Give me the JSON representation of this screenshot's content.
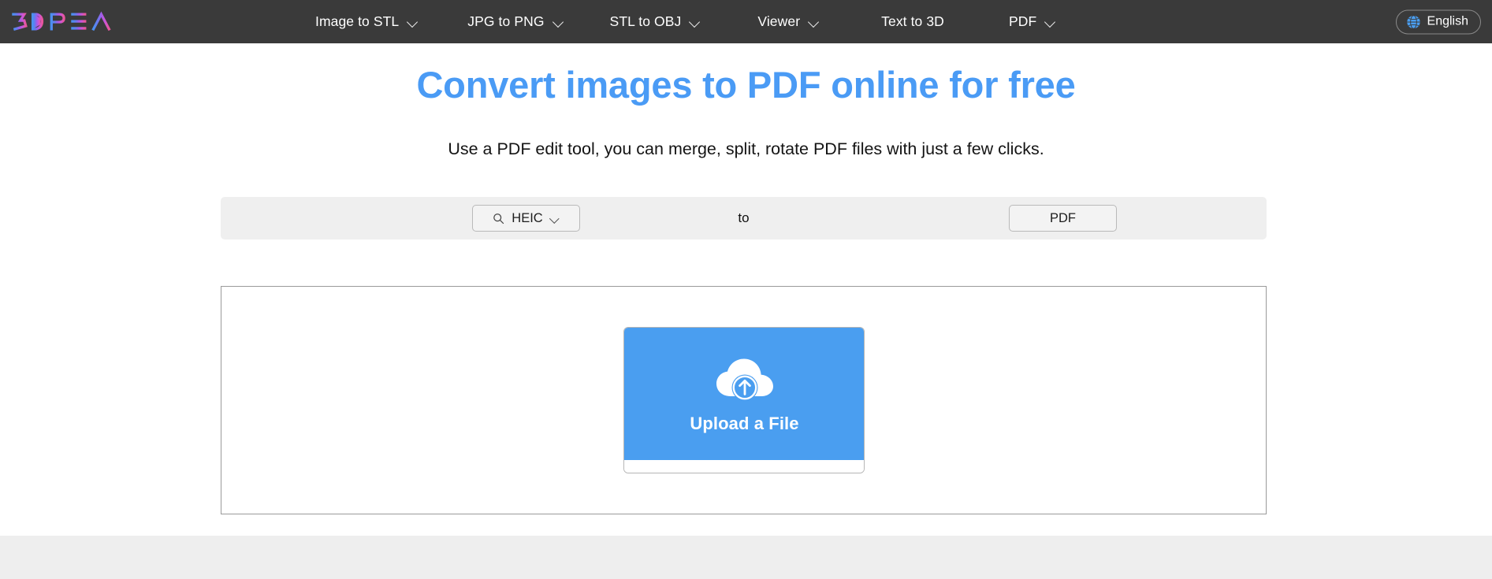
{
  "navbar": {
    "logo_text": "3DPEA",
    "logo_colors": [
      "#4a90f0",
      "#6a78ef",
      "#a35ce8",
      "#c856d8",
      "#e8569a"
    ],
    "background": "#3a3a3a",
    "items": [
      {
        "label": "Image to STL",
        "has_dropdown": true,
        "icon": "chevron-down-icon"
      },
      {
        "label": "JPG to PNG",
        "has_dropdown": true,
        "icon": "chevron-down-icon"
      },
      {
        "label": "STL to OBJ",
        "has_dropdown": true,
        "icon": "chevron-down-icon"
      },
      {
        "label": "Viewer",
        "has_dropdown": true,
        "icon": "chevron-down-icon"
      },
      {
        "label": "Text to 3D",
        "has_dropdown": false,
        "icon": ""
      },
      {
        "label": "PDF",
        "has_dropdown": true,
        "icon": "chevron-down-icon"
      }
    ],
    "language": {
      "label": "English",
      "icon": "globe-icon",
      "icon_color": "#4a9ef0"
    }
  },
  "hero": {
    "title": "Convert images to PDF online for free",
    "title_color": "#4a9bf5",
    "subtitle": "Use a PDF edit tool, you can merge, split, rotate PDF files with just a few clicks."
  },
  "converter": {
    "background": "#efefef",
    "from": {
      "value": "HEIC",
      "icon": "search-icon",
      "dropdown_icon": "chevron-down-icon"
    },
    "separator_label": "to",
    "to": {
      "value": "PDF"
    }
  },
  "dropzone": {
    "border_color": "#9a9a9a",
    "upload": {
      "label": "Upload a File",
      "icon": "cloud-upload-icon",
      "background": "#4a9ef0",
      "text_color": "#ffffff"
    }
  },
  "footer": {
    "background": "#eeeeee"
  }
}
